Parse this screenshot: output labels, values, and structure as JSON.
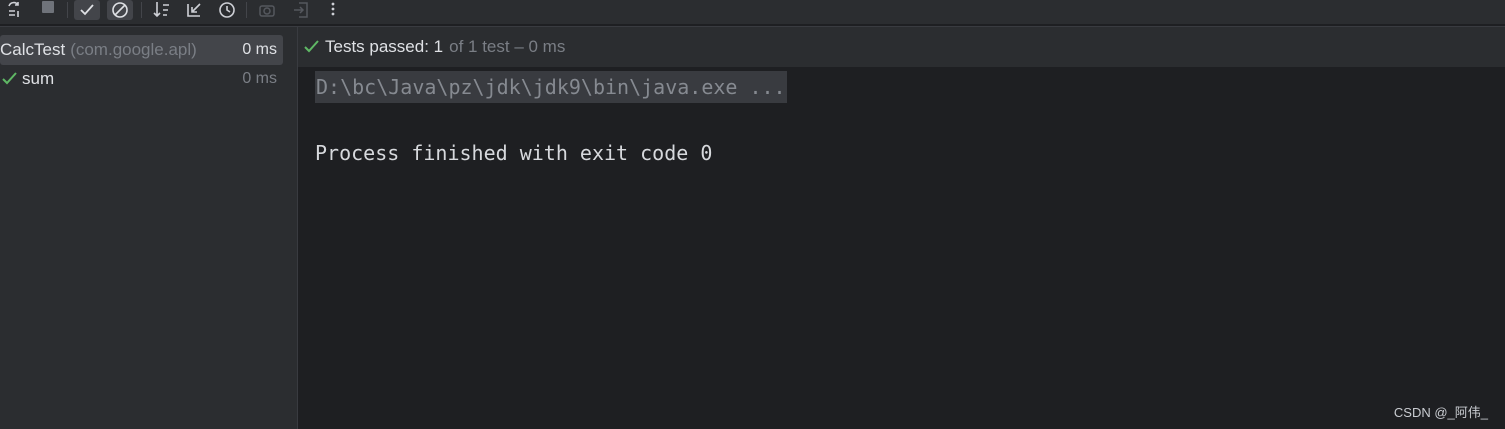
{
  "toolbar": {
    "buttons": [
      {
        "icon": "rerun-failed-icon"
      },
      {
        "icon": "stop-icon"
      },
      {
        "icon": "show-passed-icon",
        "active": true
      },
      {
        "icon": "show-ignored-icon",
        "active": true
      },
      {
        "icon": "sort-icon"
      },
      {
        "icon": "collapse-icon"
      },
      {
        "icon": "history-icon"
      },
      {
        "icon": "screenshot-icon"
      },
      {
        "icon": "export-icon"
      },
      {
        "icon": "more-icon"
      }
    ]
  },
  "tree": {
    "root": {
      "name": "CalcTest",
      "package": "(com.google.apl)",
      "duration": "0 ms"
    },
    "children": [
      {
        "name": "sum",
        "duration": "0 ms"
      }
    ]
  },
  "status": {
    "passed_label": "Tests passed: 1",
    "detail": "of 1 test – 0 ms"
  },
  "console": {
    "command": "D:\\bc\\Java\\pz\\jdk\\jdk9\\bin\\java.exe ...",
    "output": "Process finished with exit code 0"
  },
  "watermark": "CSDN @_阿伟_",
  "colors": {
    "check_green": "#5fb865",
    "panel_bg": "#2b2d30",
    "console_bg": "#1e1f22"
  }
}
